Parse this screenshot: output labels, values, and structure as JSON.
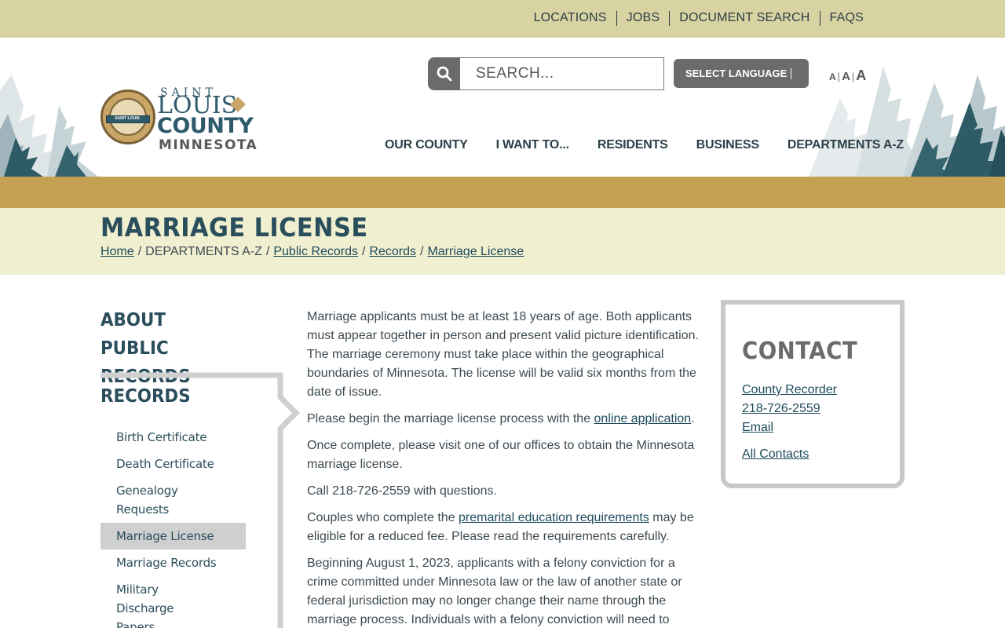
{
  "utility_nav": {
    "items": [
      "LOCATIONS",
      "JOBS",
      "DOCUMENT SEARCH",
      "FAQS"
    ]
  },
  "logo": {
    "line1": "SAINT",
    "line2": "LOUIS",
    "line3": "COUNTY",
    "line4": "MINNESOTA",
    "seal_text": "SAINT LOUIS"
  },
  "search": {
    "placeholder": "SEARCH..."
  },
  "language": {
    "label": "SELECT LANGUAGE"
  },
  "text_size": {
    "small": "A",
    "medium": "A",
    "large": "A"
  },
  "main_nav": {
    "items": [
      "OUR COUNTY",
      "I WANT TO...",
      "RESIDENTS",
      "BUSINESS",
      "DEPARTMENTS A-Z"
    ]
  },
  "page": {
    "title": "MARRIAGE LICENSE"
  },
  "breadcrumb": {
    "home": "Home",
    "departments": "DEPARTMENTS A-Z",
    "public_records": "Public Records",
    "records": "Records",
    "current": "Marriage License",
    "separator": "/"
  },
  "sidebar": {
    "heading": "ABOUT PUBLIC RECORDS",
    "subheading": "RECORDS",
    "items": [
      {
        "label": "Birth Certificate"
      },
      {
        "label": "Death Certificate"
      },
      {
        "label": "Genealogy Requests"
      },
      {
        "label": "Marriage License"
      },
      {
        "label": "Marriage Records"
      },
      {
        "label": "Military Discharge Papers"
      }
    ]
  },
  "content": {
    "p1": "Marriage applicants must be at least 18 years of age. Both applicants must appear together in person and present valid picture identification. The marriage ceremony must take place within the geographical boundaries of Minnesota. The license will be valid six months from the date of issue.",
    "p2_before": "Please begin the marriage license process with the ",
    "p2_link": "online application",
    "p2_after": ".",
    "p3": "Once complete, please visit one of our offices to obtain the Minnesota marriage license.",
    "p4": "Call 218-726-2559 with questions.",
    "p5_before": "Couples who complete the ",
    "p5_link": "premarital education requirements",
    "p5_after": " may be eligible for a reduced fee. Please read the requirements carefully.",
    "p6": "Beginning August 1, 2023, applicants with a felony conviction for a crime committed under Minnesota law or the law of another state or federal jurisdiction may no longer change their name through the marriage process. Individuals with a felony conviction will need to"
  },
  "contact": {
    "title": "CONTACT",
    "office": "County Recorder",
    "phone": "218-726-2559",
    "email": "Email",
    "all": "All Contacts"
  },
  "colors": {
    "utility_bar": "#d7d3a2",
    "gold_band": "#c4a053",
    "title_band": "#f0efd0",
    "heading": "#2b4e5c",
    "button_gray": "#6b6b6b"
  }
}
